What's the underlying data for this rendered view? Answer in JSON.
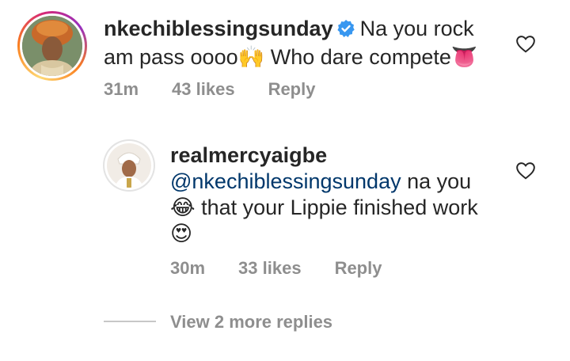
{
  "comment": {
    "username": "nkechiblessingsunday",
    "text_line1": "Na you rock",
    "text_line2": "am pass oooo",
    "emoji_1": "🙌",
    "text_line2b": "Who dare compete",
    "emoji_2": "👅",
    "time": "31m",
    "likes": "43 likes",
    "reply_label": "Reply"
  },
  "reply": {
    "username": "realmercyaigbe",
    "mention": "@nkechiblessingsunday",
    "text_line1": "na you",
    "emoji_1": "😂",
    "text_line2": "that your Lippie finished work",
    "emoji_2": "😍",
    "time": "30m",
    "likes": "33 likes",
    "reply_label": "Reply"
  },
  "more_replies": {
    "label": "View 2 more replies"
  },
  "colors": {
    "verified": "#3897f0",
    "mention": "#00376b",
    "meta": "#8e8e8e"
  },
  "icons": [
    "verified-badge-icon",
    "heart-outline-icon"
  ]
}
